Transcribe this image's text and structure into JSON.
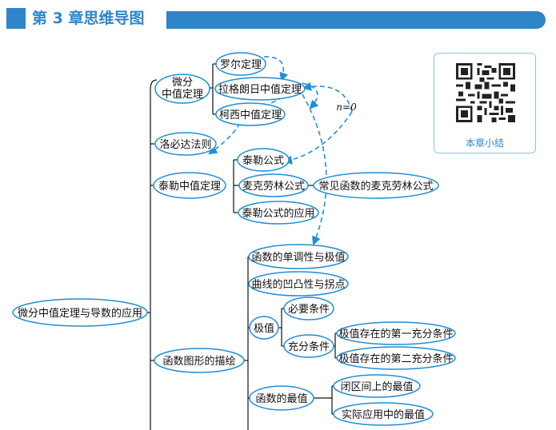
{
  "header": {
    "title": "第 3 章思维导图"
  },
  "qr": {
    "label": "本章小结"
  },
  "colors": {
    "accent": "#2e86c8",
    "node_border": "#1e8fd6",
    "link": "#1e8fd6"
  },
  "nodes": {
    "root": "微分中值定理与导数的应用",
    "wf1": "微分",
    "wf2": "中值定理",
    "rolle": "罗尔定理",
    "lagrange": "拉格朗日中值定理",
    "cauchy": "柯西中值定理",
    "lhopital": "洛必达法则",
    "taylor_thm": "泰勒中值定理",
    "taylor": "泰勒公式",
    "maclaurin": "麦克劳林公式",
    "common_maclaurin": "常见函数的麦克劳林公式",
    "taylor_app": "泰勒公式的应用",
    "graph": "函数图形的描绘",
    "mono": "函数的单调性与极值",
    "convex": "曲线的凹凸性与拐点",
    "extremum": "极值",
    "necessary": "必要条件",
    "sufficient": "充分条件",
    "suff1": "极值存在的第一充分条件",
    "suff2": "极值存在的第二充分条件",
    "maxmin": "函数的最值",
    "closed": "闭区间上的最值",
    "practical": "实际应用中的最值"
  },
  "annotations": {
    "n0": "n=0"
  }
}
